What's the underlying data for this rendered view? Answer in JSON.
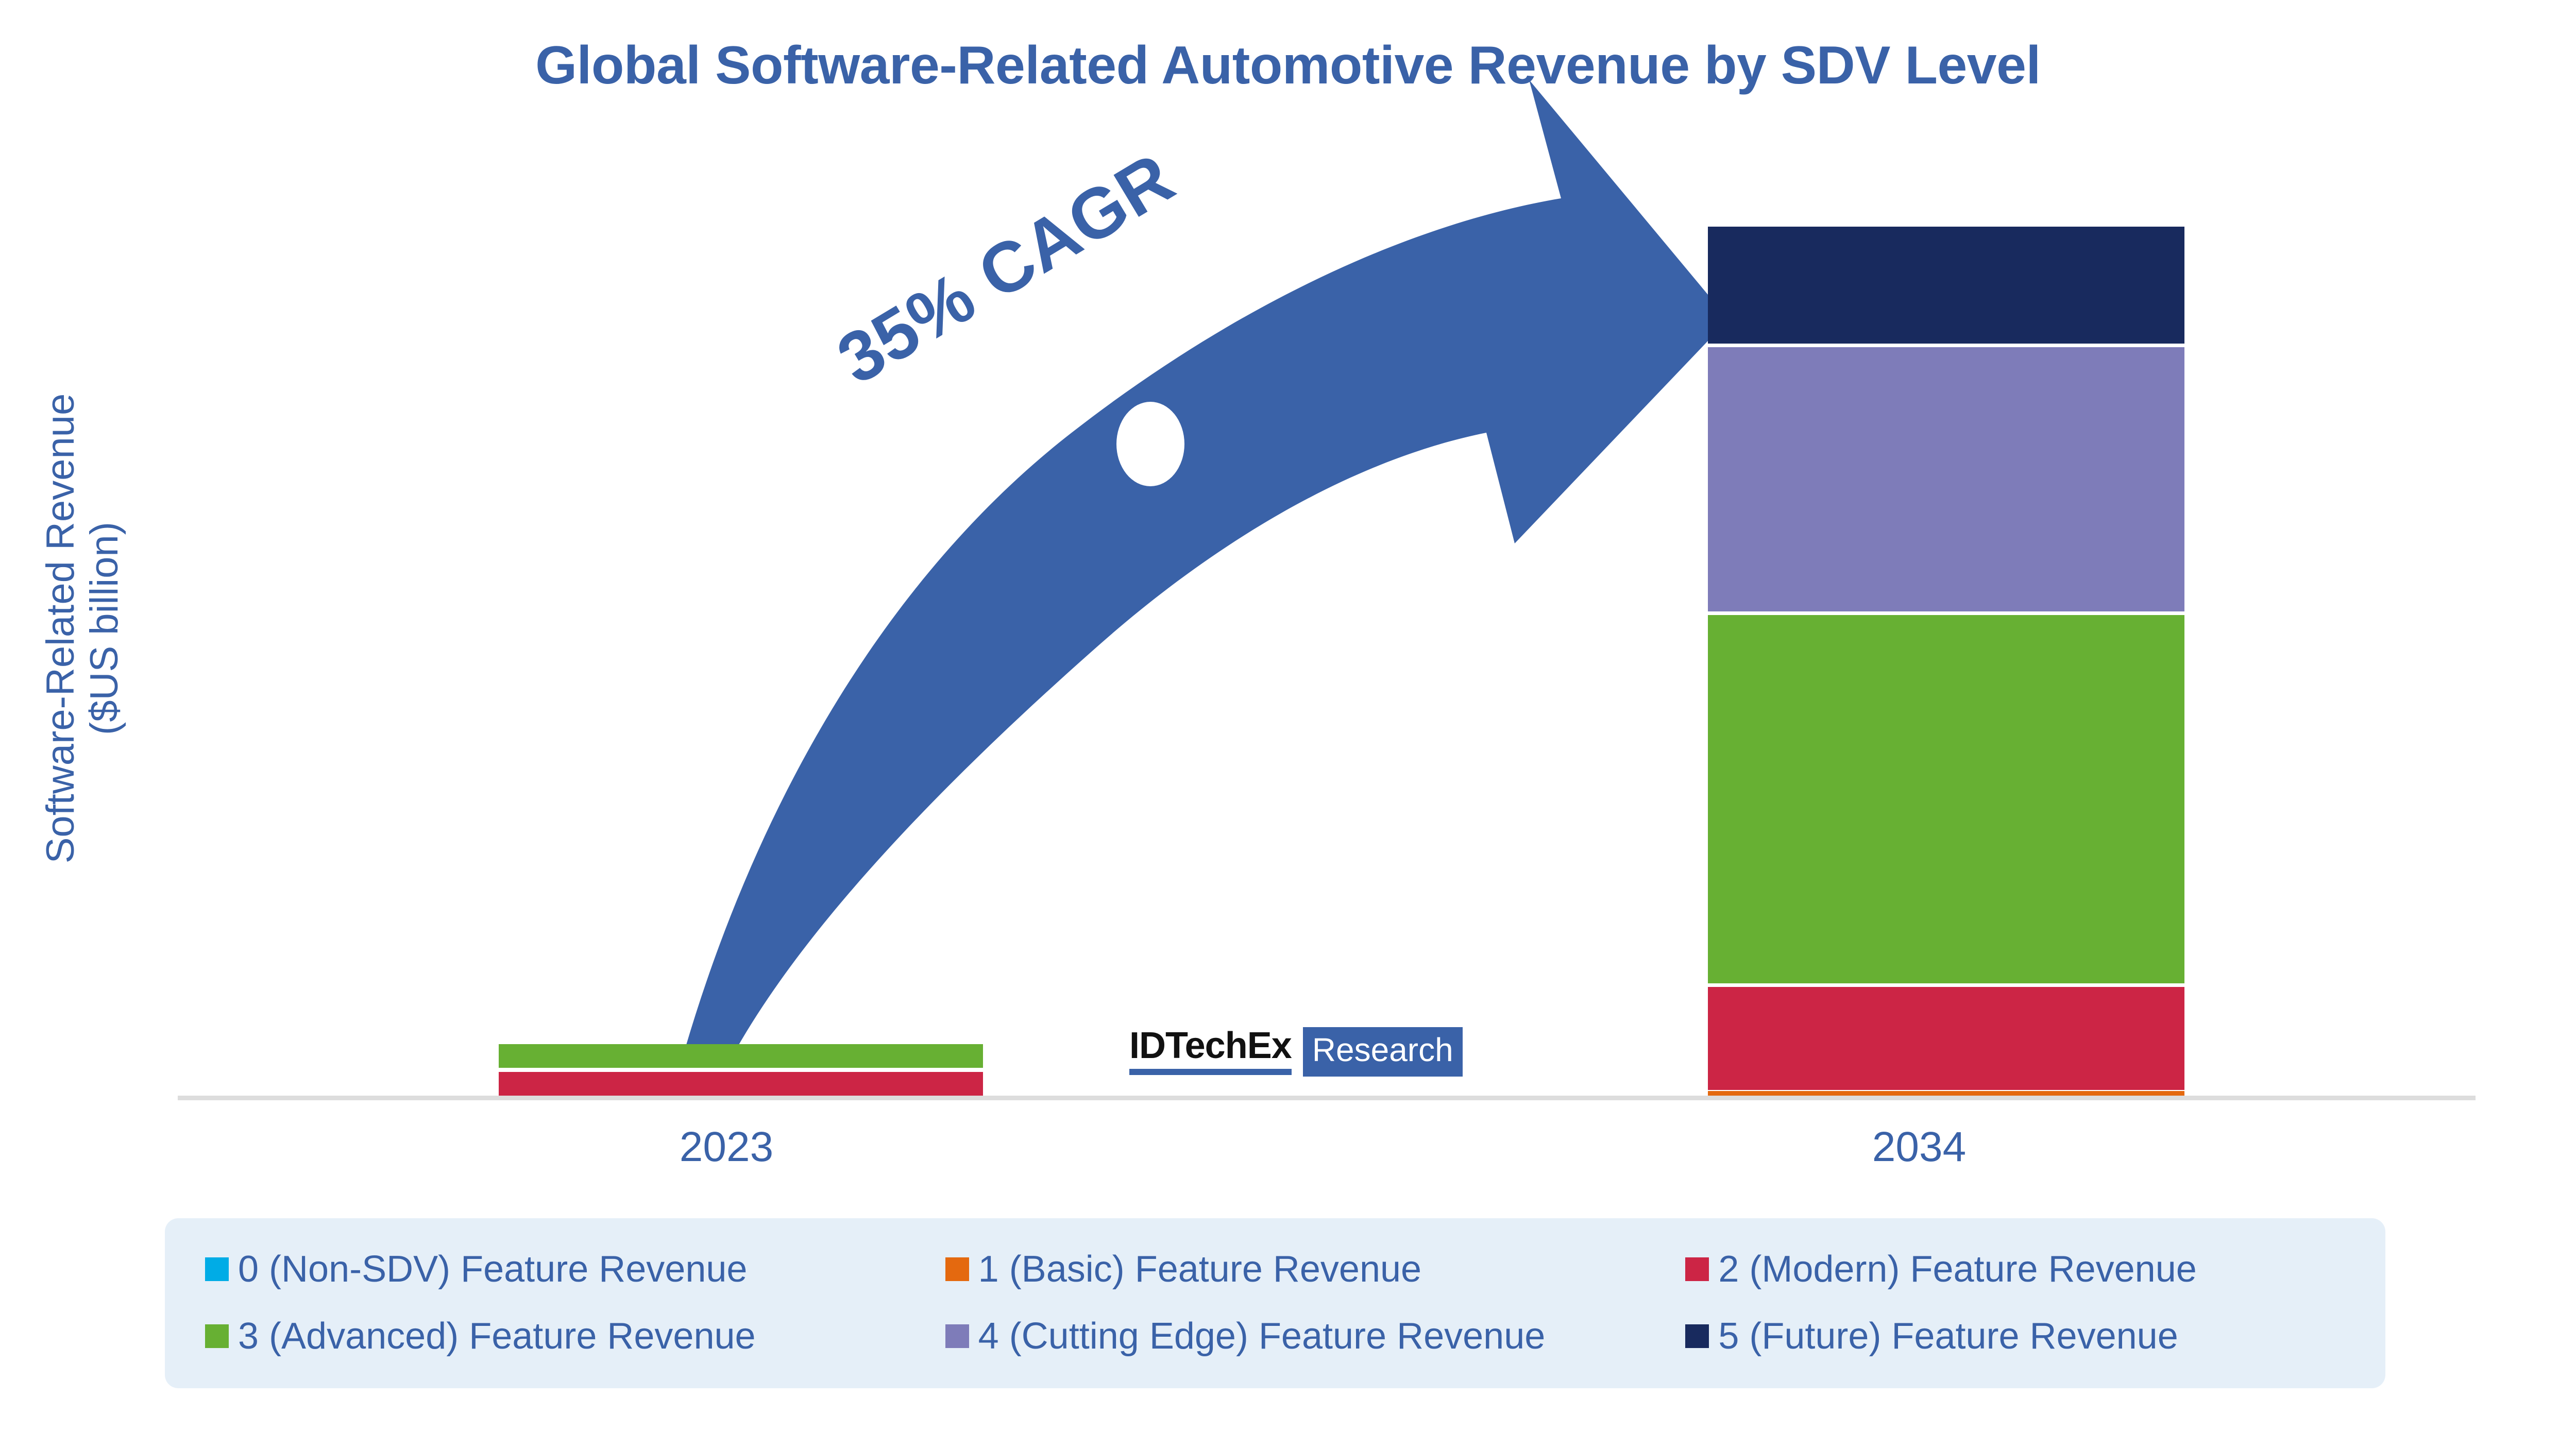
{
  "chart_data": {
    "type": "bar",
    "subtype": "stacked-bar",
    "title": "Global Software-Related Automotive Revenue by SDV Level",
    "xlabel": "",
    "ylabel": "Software-Related Revenue\n($US billion)",
    "ylabel_lines": [
      "Software-Related Revenue",
      "($US billion)"
    ],
    "categories": [
      "2023",
      "2034"
    ],
    "grid": false,
    "legend_position": "bottom",
    "annotations": [
      {
        "text": "35% CAGR",
        "kind": "growth-arrow-label"
      }
    ],
    "series": [
      {
        "name": "0 (Non-SDV) Feature Revenue",
        "color": "#00ACE6",
        "values": [
          0,
          0
        ]
      },
      {
        "name": "1 (Basic) Feature Revenue",
        "color": "#E4690F",
        "values": [
          0,
          3
        ]
      },
      {
        "name": "2 (Modern) Feature Revenue",
        "color": "#CC2545",
        "values": [
          11,
          40
        ]
      },
      {
        "name": "3 (Advanced) Feature Revenue",
        "color": "#67B033",
        "values": [
          12,
          335
        ]
      },
      {
        "name": "4 (Cutting Edge) Feature Revenue",
        "color": "#7E7CB9",
        "values": [
          0,
          240
        ]
      },
      {
        "name": "5 (Future) Feature Revenue",
        "color": "#182A5E",
        "values": [
          0,
          116
        ]
      }
    ],
    "totals": [
      23,
      734
    ],
    "ylim": [
      0,
      780
    ],
    "axis_color": "#DDDDDD"
  },
  "title": {
    "text": "Global Software-Related Automotive Revenue by SDV Level"
  },
  "yaxis": {
    "line1": "Software-Related Revenue",
    "line2": "($US billion)"
  },
  "xaxis": {
    "ticks": [
      {
        "label": "2023"
      },
      {
        "label": "2034"
      }
    ]
  },
  "annotation": {
    "cagr": "35% CAGR"
  },
  "logo": {
    "name": "IDTechEx",
    "suffix": "Research"
  },
  "legend": {
    "items": [
      {
        "label": "0 (Non-SDV) Feature Revenue",
        "color": "#00ACE6"
      },
      {
        "label": "1 (Basic) Feature Revenue",
        "color": "#E4690F"
      },
      {
        "label": "2 (Modern) Feature Revenue",
        "color": "#CC2545"
      },
      {
        "label": "3 (Advanced) Feature Revenue",
        "color": "#67B033"
      },
      {
        "label": "4 (Cutting Edge) Feature Revenue",
        "color": "#7E7CB9"
      },
      {
        "label": "5 (Future) Feature Revenue",
        "color": "#182A5E"
      }
    ]
  },
  "colors": {
    "title_blue": "#3A62A8",
    "arrow_blue": "#3A62A8",
    "legend_bg": "#E5EFF8",
    "axis_gray": "#DDDDDD",
    "background": "#FFFFFF"
  }
}
